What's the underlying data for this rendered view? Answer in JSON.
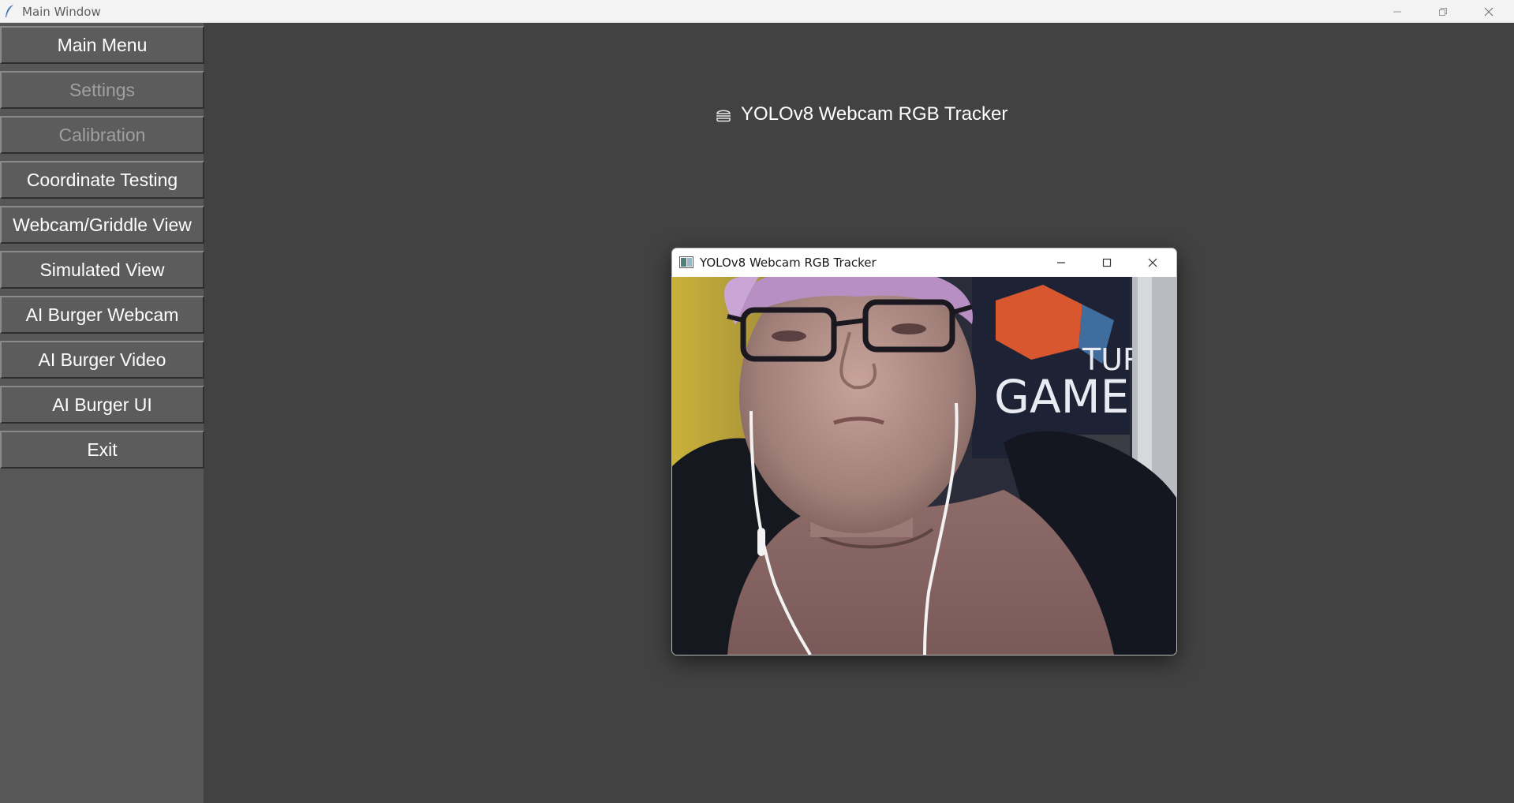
{
  "window": {
    "title": "Main Window",
    "icon": "feather-icon"
  },
  "sidebar": {
    "items": [
      {
        "label": "Main Menu",
        "enabled": true
      },
      {
        "label": "Settings",
        "enabled": false
      },
      {
        "label": "Calibration",
        "enabled": false
      },
      {
        "label": "Coordinate Testing",
        "enabled": true
      },
      {
        "label": "Webcam/Griddle View",
        "enabled": true
      },
      {
        "label": "Simulated View",
        "enabled": true
      },
      {
        "label": "AI Burger Webcam",
        "enabled": true
      },
      {
        "label": "AI Burger Video",
        "enabled": true
      },
      {
        "label": "AI Burger UI",
        "enabled": true
      },
      {
        "label": "Exit",
        "enabled": true
      }
    ]
  },
  "main": {
    "heading": "YOLOv8 Webcam RGB Tracker",
    "heading_icon": "burger-icon"
  },
  "popup": {
    "title": "YOLOv8 Webcam RGB Tracker",
    "icon": "opencv-window-icon",
    "feed_poster_text": [
      "TUR",
      "GAME"
    ]
  },
  "colors": {
    "background": "#424242",
    "sidebar": "#575757",
    "button": "#5c5c5c",
    "disabled_text": "#a0a0a0"
  }
}
